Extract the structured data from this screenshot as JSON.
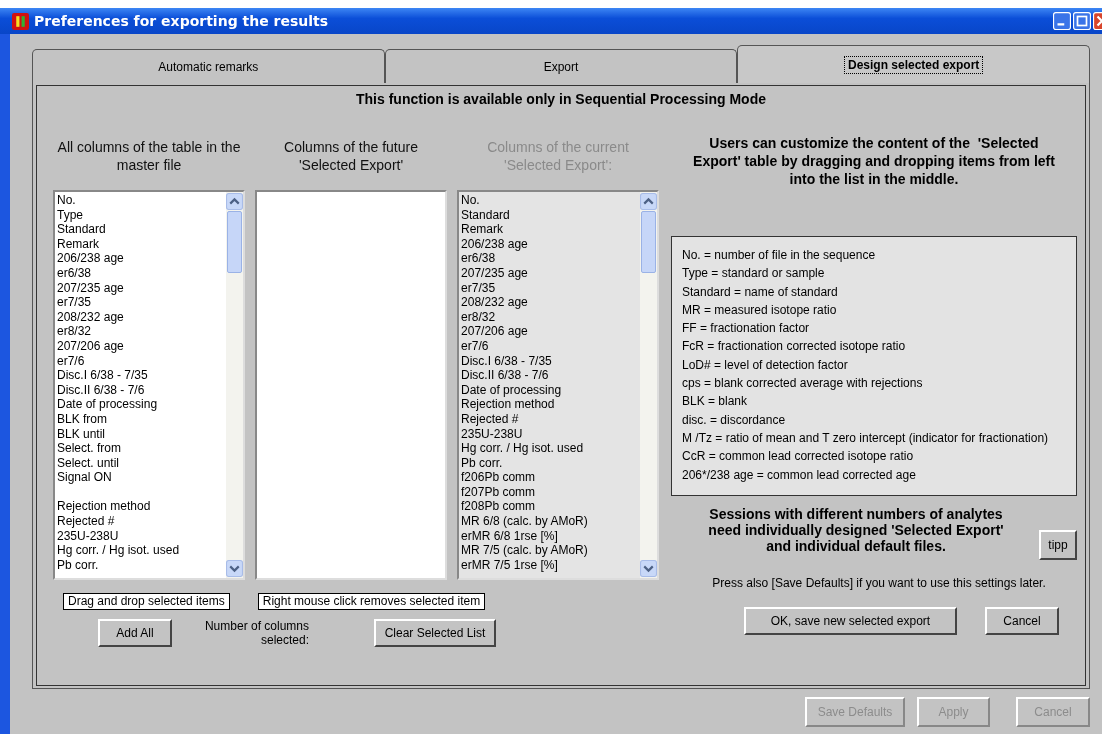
{
  "window": {
    "title": "Preferences for exporting the results"
  },
  "tabs": [
    {
      "label": "Automatic remarks",
      "selected": false
    },
    {
      "label": "Export",
      "selected": false
    },
    {
      "label": "Design selected export",
      "selected": true
    }
  ],
  "notice": "This function is available only in Sequential Processing Mode",
  "lists": [
    {
      "heading": "All columns of the table in the master file",
      "disabled": false,
      "items": [
        "No.",
        "Type",
        "Standard",
        "Remark",
        "206/238 age",
        "er6/38",
        "207/235 age",
        "er7/35",
        "208/232 age",
        "er8/32",
        "207/206 age",
        "er7/6",
        "Disc.I 6/38 - 7/35",
        "Disc.II 6/38 - 7/6",
        "Date of processing",
        "BLK from",
        "BLK until",
        "Select. from",
        "Select. until",
        "Signal ON",
        {
          "kind": "blank"
        },
        "Rejection method",
        "Rejected #",
        "235U-238U",
        "Hg corr. / Hg isot. used",
        "Pb corr."
      ]
    },
    {
      "heading": "Columns of the future 'Selected Export'",
      "disabled": false
    },
    {
      "heading": "Columns of the current 'Selected Export':",
      "disabled": true,
      "items": [
        "No.",
        "Standard",
        "Remark",
        "206/238 age",
        "er6/38",
        "207/235 age",
        "er7/35",
        "208/232 age",
        "er8/32",
        "207/206 age",
        "er7/6",
        "Disc.I 6/38 - 7/35",
        "Disc.II 6/38 - 7/6",
        "Date of processing",
        "Rejection method",
        "Rejected #",
        "235U-238U",
        "Hg corr. / Hg isot. used",
        "Pb corr.",
        "f206Pb comm",
        "f207Pb comm",
        "f208Pb comm",
        "MR 6/8  (calc. by AMoR)",
        "erMR 6/8 1rse [%]",
        "MR 7/5  (calc. by AMoR)",
        "erMR 7/5 1rse [%]"
      ]
    }
  ],
  "hints": [
    "Drag and drop selected items",
    "Right mouse click removes selected item"
  ],
  "add_all_button": "Add All",
  "count_label": "Number of columns selected:",
  "clear_button": "Clear Selected List",
  "description": "Users can customize the content of the  'Selected Export' table by dragging and dropping items from left into the list in the middle.",
  "legend": [
    "No. = number of file in the sequence",
    "Type = standard or sample",
    "Standard = name of standard",
    "MR = measured isotope ratio",
    "FF = fractionation factor",
    "FcR = fractionation corrected isotope ratio",
    "LoD#  = level of detection factor",
    "cps = blank corrected average with rejections",
    "BLK  = blank",
    "disc. = discordance",
    "M /Tz = ratio of mean and T zero intercept (indicator for fractionation)",
    "CcR = common lead corrected isotope ratio",
    "206*/238 age = common lead corrected age"
  ],
  "sessions_note": "Sessions with different numbers of analytes need individually designed 'Selected Export' and individual default files.",
  "tipp_button": "tipp",
  "save_note": "Press also [Save Defaults] if you want to use this settings later.",
  "ok_button": "OK, save new selected export",
  "cancel_button": "Cancel",
  "footer_buttons": [
    {
      "label": "Save Defaults",
      "disabled": true
    },
    {
      "label": "Apply",
      "disabled": true
    },
    {
      "label": "Cancel",
      "disabled": true
    }
  ]
}
